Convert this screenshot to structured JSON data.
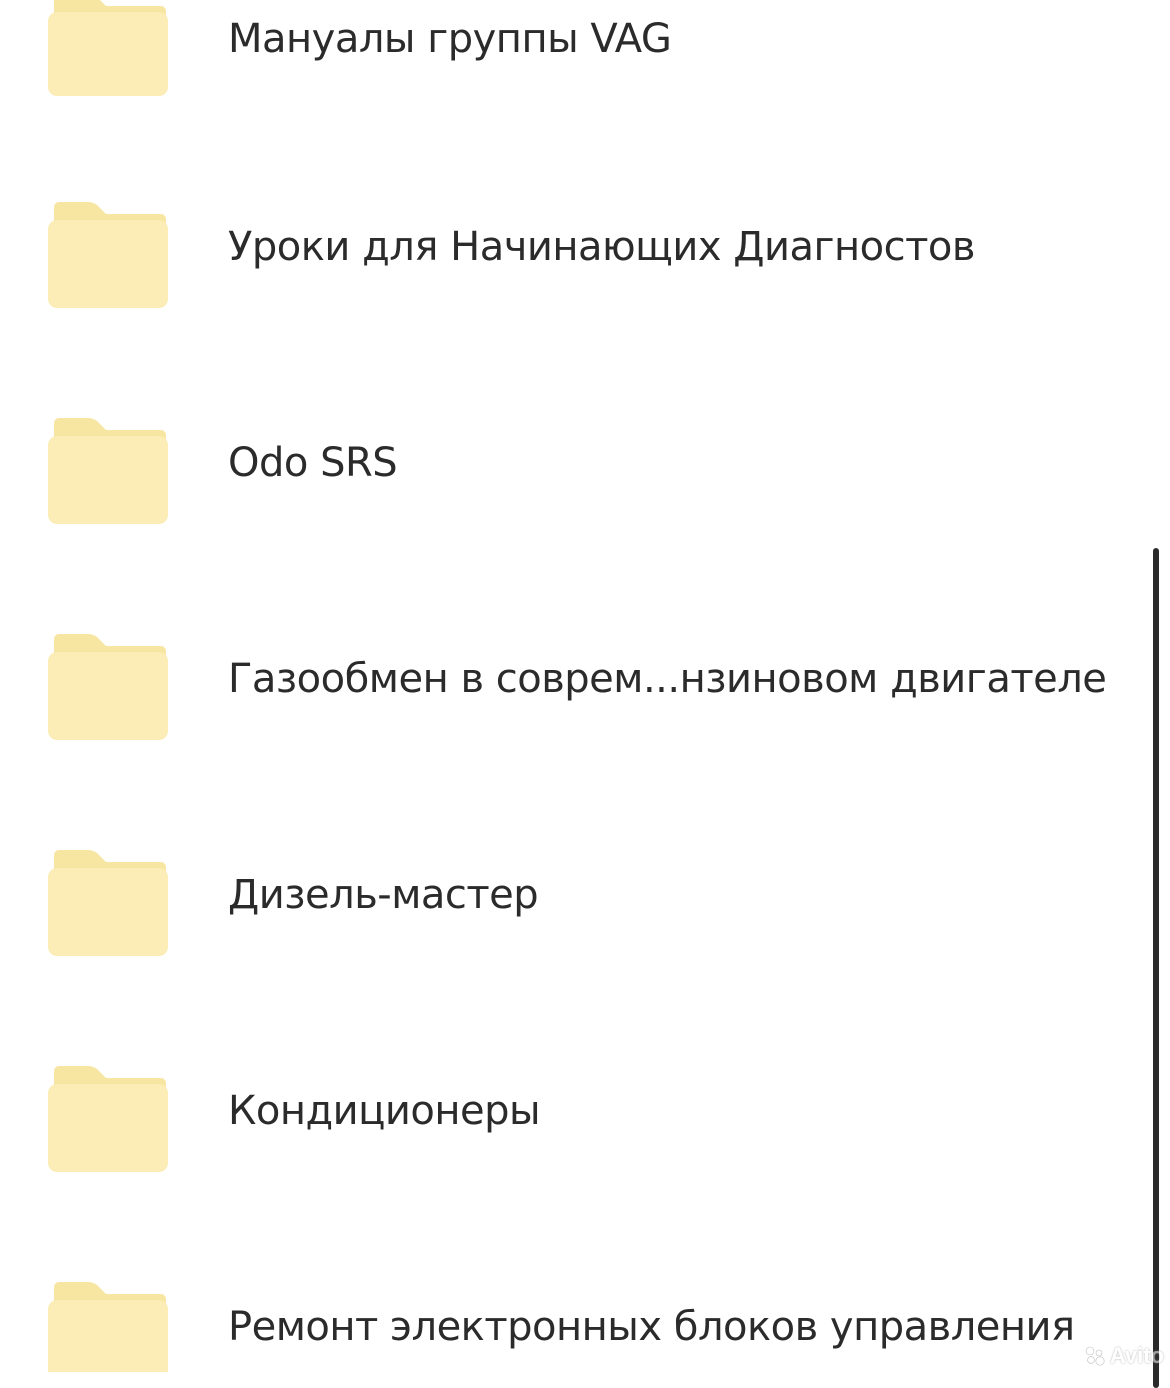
{
  "colors": {
    "folder_back": "#F7E5A2",
    "folder_front": "#FCEDB6",
    "text": "#2B2B2B",
    "scrollbar": "#2A2A2A",
    "background": "#FFFFFF"
  },
  "folders": [
    {
      "name": "Мануалы группы VAG",
      "icon": "folder-icon"
    },
    {
      "name": "Уроки для Начинающих Диагностов",
      "icon": "folder-icon"
    },
    {
      "name": "Odo SRS",
      "icon": "folder-icon"
    },
    {
      "name": "Газообмен в соврем...нзиновом двигателе",
      "icon": "folder-icon"
    },
    {
      "name": "Дизель-мастер",
      "icon": "folder-icon"
    },
    {
      "name": "Кондиционеры",
      "icon": "folder-icon"
    },
    {
      "name": "Ремонт электронных блоков управления",
      "icon": "folder-icon"
    }
  ],
  "watermark": {
    "text": "Avito",
    "icon": "avito-logo-icon"
  }
}
